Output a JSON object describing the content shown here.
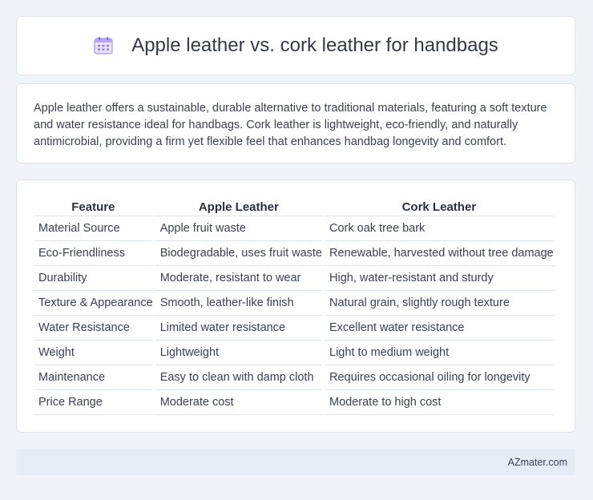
{
  "header": {
    "icon": "calendar-icon",
    "title": "Apple leather vs. cork leather for handbags"
  },
  "summary": {
    "text": "Apple leather offers a sustainable, durable alternative to traditional materials, featuring a soft texture and water resistance ideal for handbags. Cork leather is lightweight, eco-friendly, and naturally antimicrobial, providing a firm yet flexible feel that enhances handbag longevity and comfort."
  },
  "table": {
    "headers": [
      "Feature",
      "Apple Leather",
      "Cork Leather"
    ],
    "rows": [
      [
        "Material Source",
        "Apple fruit waste",
        "Cork oak tree bark"
      ],
      [
        "Eco-Friendliness",
        "Biodegradable, uses fruit waste",
        "Renewable, harvested without tree damage"
      ],
      [
        "Durability",
        "Moderate, resistant to wear",
        "High, water-resistant and sturdy"
      ],
      [
        "Texture & Appearance",
        "Smooth, leather-like finish",
        "Natural grain, slightly rough texture"
      ],
      [
        "Water Resistance",
        "Limited water resistance",
        "Excellent water resistance"
      ],
      [
        "Weight",
        "Lightweight",
        "Light to medium weight"
      ],
      [
        "Maintenance",
        "Easy to clean with damp cloth",
        "Requires occasional oiling for longevity"
      ],
      [
        "Price Range",
        "Moderate cost",
        "Moderate to high cost"
      ]
    ]
  },
  "footer": {
    "brand": "AZmater.com"
  }
}
